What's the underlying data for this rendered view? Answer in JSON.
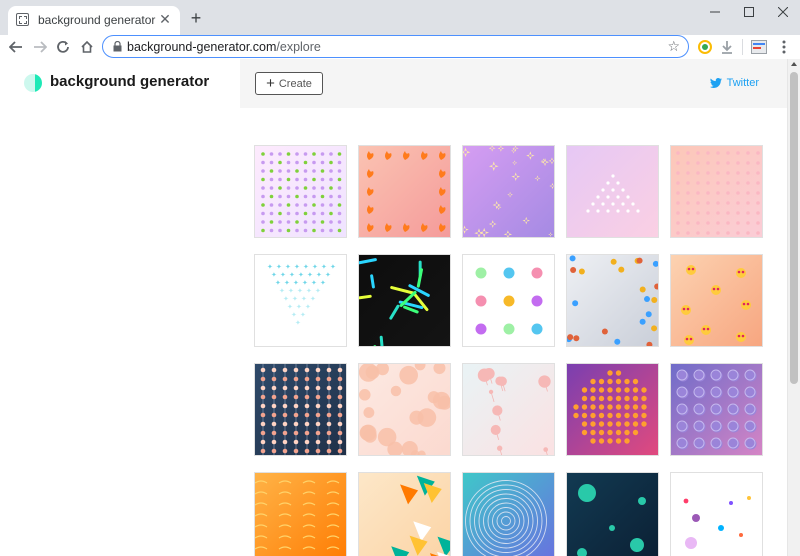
{
  "browser": {
    "tab": {
      "title": "background generator",
      "favicon": "page-favicon",
      "close_icon": "close-icon"
    },
    "new_tab_icon": "plus-icon",
    "window_controls": [
      "minimize-icon",
      "maximize-icon",
      "close-icon"
    ],
    "nav": [
      "back-arrow-icon",
      "forward-arrow-icon",
      "reload-icon",
      "home-icon"
    ],
    "url": {
      "host": "background-generator.com",
      "path": "/explore"
    },
    "extensions": [
      "google-drive-icon",
      "download-icon",
      "extension-icon",
      "menu-dots-icon"
    ]
  },
  "header": {
    "logo_text": "background generator",
    "create_label": "Create",
    "twitter_label": "Twitter"
  },
  "tiles": [
    {
      "name": "dots-green-violet",
      "bg": [
        "#fdeafd",
        "#efe3ff"
      ]
    },
    {
      "name": "fire-emoji-peach",
      "bg": [
        "#fbc3b2",
        "#f49a9a"
      ]
    },
    {
      "name": "sparkles-lavender",
      "bg": [
        "#d59df2",
        "#a48ae3"
      ]
    },
    {
      "name": "stars-triangle-pink",
      "bg": [
        "#e6c8f5",
        "#fbd0e3"
      ]
    },
    {
      "name": "dot-grid-salmon",
      "bg": [
        "#fcc7b8",
        "#fbcdd7"
      ]
    },
    {
      "name": "triangle-cyan-stars",
      "bg": [
        "#ffffff",
        "#ffffff"
      ]
    },
    {
      "name": "neon-sticks-black",
      "bg": [
        "#0d0d0d",
        "#141414"
      ]
    },
    {
      "name": "colored-balls-grid",
      "bg": [
        "#ffffff",
        "#ffffff"
      ]
    },
    {
      "name": "bees-butterflies",
      "bg": [
        "#eef0f4",
        "#c9ced8"
      ]
    },
    {
      "name": "heart-eyes-emoji",
      "bg": [
        "#fcd2b1",
        "#f7a57f"
      ]
    },
    {
      "name": "bead-strings-navy",
      "bg": [
        "#2f4a6a",
        "#1f3048"
      ]
    },
    {
      "name": "peach-bubbles",
      "bg": [
        "#fde9e2",
        "#fbd9cf"
      ]
    },
    {
      "name": "lollipop-bubbles",
      "bg": [
        "#e9f3f5",
        "#fbe1e2"
      ]
    },
    {
      "name": "orange-dot-sphere",
      "bg": [
        "#7a3fb0",
        "#e34a7d"
      ]
    },
    {
      "name": "embossed-circles-purple",
      "bg": [
        "#6f6cc9",
        "#d785c5"
      ]
    },
    {
      "name": "orange-waves",
      "bg": [
        "#ffb347",
        "#ff7a00"
      ]
    },
    {
      "name": "confetti-shards",
      "bg": [
        "#fde7c8",
        "#fbd3a4"
      ]
    },
    {
      "name": "concentric-rings-teal",
      "bg": [
        "#3fc7c9",
        "#6a6ee0"
      ]
    },
    {
      "name": "teal-orbs-navy",
      "bg": [
        "#123a52",
        "#0b1f33"
      ]
    },
    {
      "name": "scattered-dots-white",
      "bg": [
        "#ffffff",
        "#ffffff"
      ]
    }
  ]
}
